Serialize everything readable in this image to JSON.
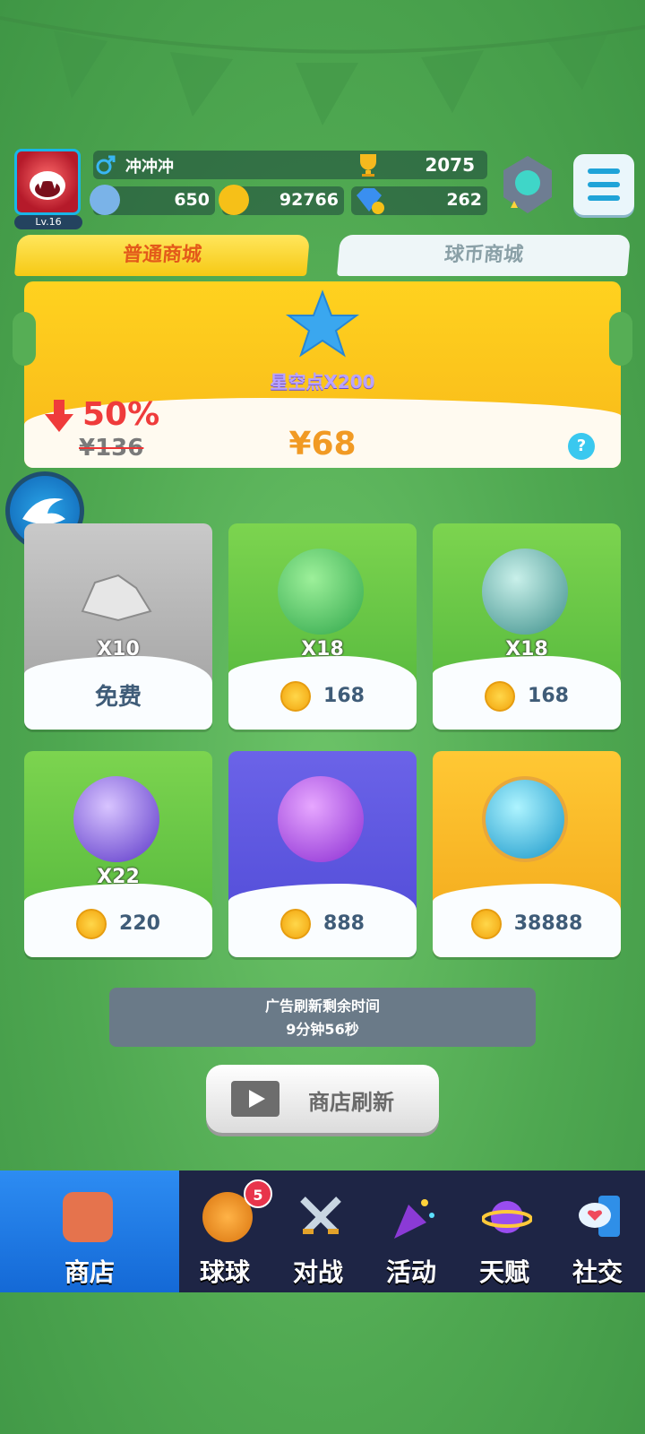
{
  "header": {
    "level": "Lv.16",
    "player_name": "冲冲冲",
    "trophies": "2075",
    "stardust": "650",
    "coins": "92766",
    "gems": "262"
  },
  "tabs": [
    {
      "label": "普通商城",
      "active": true
    },
    {
      "label": "球币商城",
      "active": false
    }
  ],
  "banner": {
    "item_label": "星空点X200",
    "discount": "50%",
    "original_price": "¥136",
    "price": "¥68"
  },
  "shop_items": [
    {
      "qty": "X10",
      "price": "",
      "action": "免费",
      "icon": "stone-icon",
      "bg": "#b5b5b5"
    },
    {
      "qty": "X18",
      "price": "168",
      "icon": "skull-orb-icon",
      "bg": "#66c445"
    },
    {
      "qty": "X18",
      "price": "168",
      "icon": "chain-orb-icon",
      "bg": "#66c445"
    },
    {
      "qty": "X22",
      "price": "220",
      "icon": "clover-orb-icon",
      "bg": "#66c445"
    },
    {
      "qty": "",
      "price": "888",
      "icon": "cloud-orb-icon",
      "bg": "#5c56df"
    },
    {
      "qty": "",
      "price": "38888",
      "icon": "ice-orb-icon",
      "bg": "#f6b828"
    }
  ],
  "refresh": {
    "timer_title": "广告刷新剩余时间",
    "timer_value": "9分钟56秒",
    "button_label": "商店刷新"
  },
  "nav": [
    {
      "label": "商店",
      "icon": "shop-icon",
      "active": true
    },
    {
      "label": "球球",
      "icon": "ball-icon",
      "badge": "5"
    },
    {
      "label": "对战",
      "icon": "swords-icon"
    },
    {
      "label": "活动",
      "icon": "party-popper-icon"
    },
    {
      "label": "天赋",
      "icon": "planet-icon"
    },
    {
      "label": "社交",
      "icon": "chat-phone-icon"
    }
  ]
}
